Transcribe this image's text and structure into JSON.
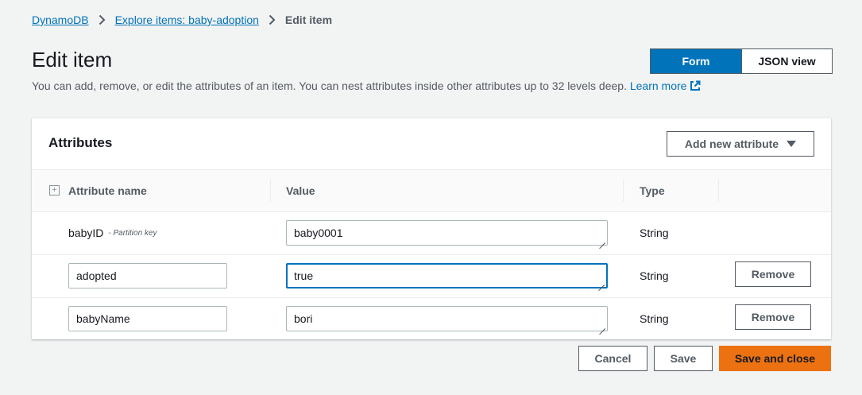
{
  "breadcrumb": {
    "items": [
      "DynamoDB",
      "Explore items: baby-adoption"
    ],
    "current": "Edit item"
  },
  "page": {
    "title": "Edit item",
    "description": "You can add, remove, or edit the attributes of an item. You can nest attributes inside other attributes up to 32 levels deep.",
    "learn_more": "Learn more"
  },
  "view_toggle": {
    "options": [
      "Form",
      "JSON view"
    ],
    "selected": "Form"
  },
  "attributes": {
    "title": "Attributes",
    "add_button": "Add new attribute",
    "columns": [
      "Attribute name",
      "Value",
      "Type"
    ],
    "rows": [
      {
        "name": "babyID",
        "key_tag": "- Partition key",
        "value": "baby0001",
        "type": "String"
      },
      {
        "name": "adopted",
        "value": "true",
        "type": "String",
        "remove": "Remove"
      },
      {
        "name": "babyName",
        "value": "bori",
        "type": "String",
        "remove": "Remove"
      }
    ]
  },
  "footer": {
    "cancel": "Cancel",
    "save": "Save",
    "save_close": "Save and close"
  },
  "colors": {
    "accent": "#0073bb",
    "primary_button": "#ec7211",
    "background": "#f2f3f3"
  },
  "icons": [
    "chevron-right-icon",
    "external-link-icon",
    "caret-down-icon",
    "expand-icon",
    "resize-grip-icon"
  ]
}
